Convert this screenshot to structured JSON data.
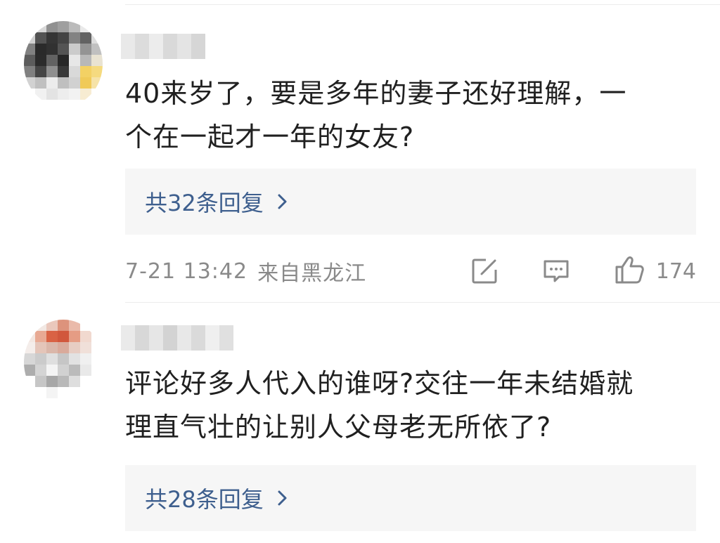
{
  "comments": [
    {
      "text_line1": "40来岁了，要是多年的妻子还好理解，一",
      "text_line2": "个在一起才一年的女友?",
      "reply_label": "共32条回复",
      "timestamp": "7-21 13:42",
      "location": "来自黑龙江",
      "like_count": "174",
      "icons": [
        "share-icon",
        "comment-icon",
        "like-icon"
      ]
    },
    {
      "text_line1": "评论好多人代入的谁呀?交往一年未结婚就",
      "text_line2": "理直气壮的让别人父母老无所依了?",
      "reply_label": "共28条回复"
    }
  ],
  "colors": {
    "reply_link": "#3e5f8e",
    "meta_gray": "#8a8a8a",
    "reply_box_bg": "#f6f6f6"
  }
}
